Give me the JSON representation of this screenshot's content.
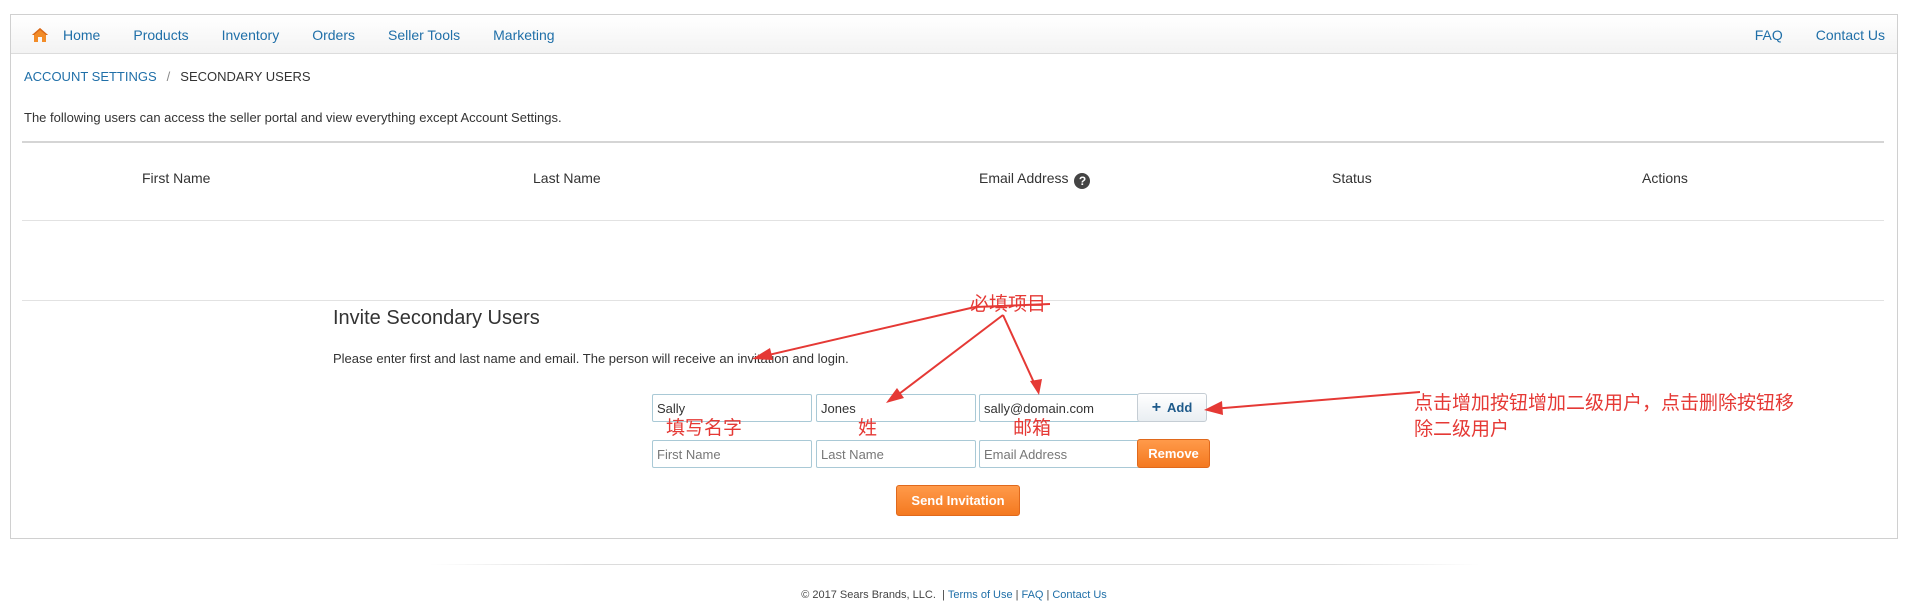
{
  "nav": {
    "home_icon": "home-icon",
    "items": [
      {
        "label": "Home"
      },
      {
        "label": "Products"
      },
      {
        "label": "Inventory"
      },
      {
        "label": "Orders"
      },
      {
        "label": "Seller Tools"
      },
      {
        "label": "Marketing"
      }
    ],
    "right_items": [
      {
        "label": "FAQ"
      },
      {
        "label": "Contact Us"
      }
    ]
  },
  "breadcrumb": {
    "parent": "ACCOUNT SETTINGS",
    "separator": "/",
    "current": "SECONDARY USERS"
  },
  "intro": "The following users can access the seller portal and view everything except Account Settings.",
  "table": {
    "headers": {
      "first_name": "First Name",
      "last_name": "Last Name",
      "email": "Email Address",
      "status": "Status",
      "actions": "Actions"
    },
    "help_icon": "question-circle-icon",
    "rows": []
  },
  "invite": {
    "title": "Invite Secondary Users",
    "description": "Please enter first and last name and email. The person will receive an invitation and login.",
    "rows": [
      {
        "first_name": {
          "value": "Sally",
          "placeholder": "First Name"
        },
        "last_name": {
          "value": "Jones",
          "placeholder": "Last Name"
        },
        "email": {
          "value": "sally@domain.com",
          "placeholder": "Email Address"
        },
        "action_label": "Add",
        "action_icon": "plus-icon"
      },
      {
        "first_name": {
          "value": "",
          "placeholder": "First Name"
        },
        "last_name": {
          "value": "",
          "placeholder": "Last Name"
        },
        "email": {
          "value": "",
          "placeholder": "Email Address"
        },
        "action_label": "Remove"
      }
    ],
    "send_label": "Send Invitation"
  },
  "annotations": {
    "required": "必填项目",
    "first_name": "填写名字",
    "last_name": "姓",
    "email": "邮箱",
    "add_remove_line1": "点击增加按钮增加二级用户，点击删除按钮移",
    "add_remove_line2": "除二级用户",
    "color": "#e53935"
  },
  "footer": {
    "copyright": "© 2017 Sears Brands, LLC.",
    "separator": "|",
    "links": [
      "Terms of Use",
      "FAQ",
      "Contact Us"
    ]
  },
  "colors": {
    "link": "#1f6fa8",
    "accent_orange": "#f47920",
    "field_border": "#a9c9d6"
  }
}
